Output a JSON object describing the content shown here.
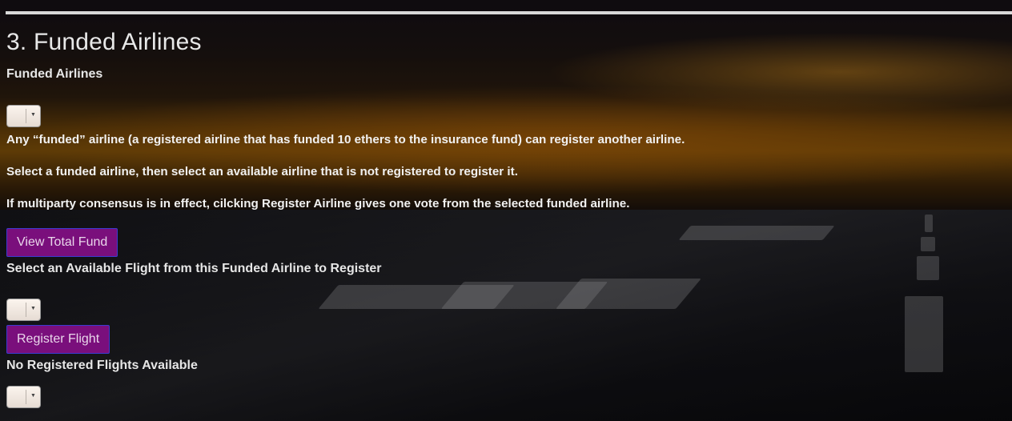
{
  "section": {
    "title": "3. Funded Airlines",
    "subtitle": "Funded Airlines"
  },
  "funded_airline_select": {
    "selected": ""
  },
  "info": {
    "line1": "Any “funded” airline (a registered airline that has funded 10 ethers to the insurance fund) can register another airline.",
    "line2": "Select a funded airline, then select an available airline that is not registered to register it.",
    "line3": "If multiparty consensus is in effect, cilcking Register Airline gives one vote from the selected funded airline."
  },
  "buttons": {
    "view_total_fund": "View Total Fund",
    "register_flight": "Register Flight"
  },
  "available_flight": {
    "label": "Select an Available Flight from this Funded Airline to Register",
    "selected": ""
  },
  "registered_flights": {
    "label": "No Registered Flights Available",
    "selected": ""
  },
  "colors": {
    "button_bg": "#7a0f7c",
    "button_border": "#3b3bd0",
    "text": "#e6e6e6"
  },
  "icons": {
    "select_arrow": "chevron-down-icon"
  }
}
